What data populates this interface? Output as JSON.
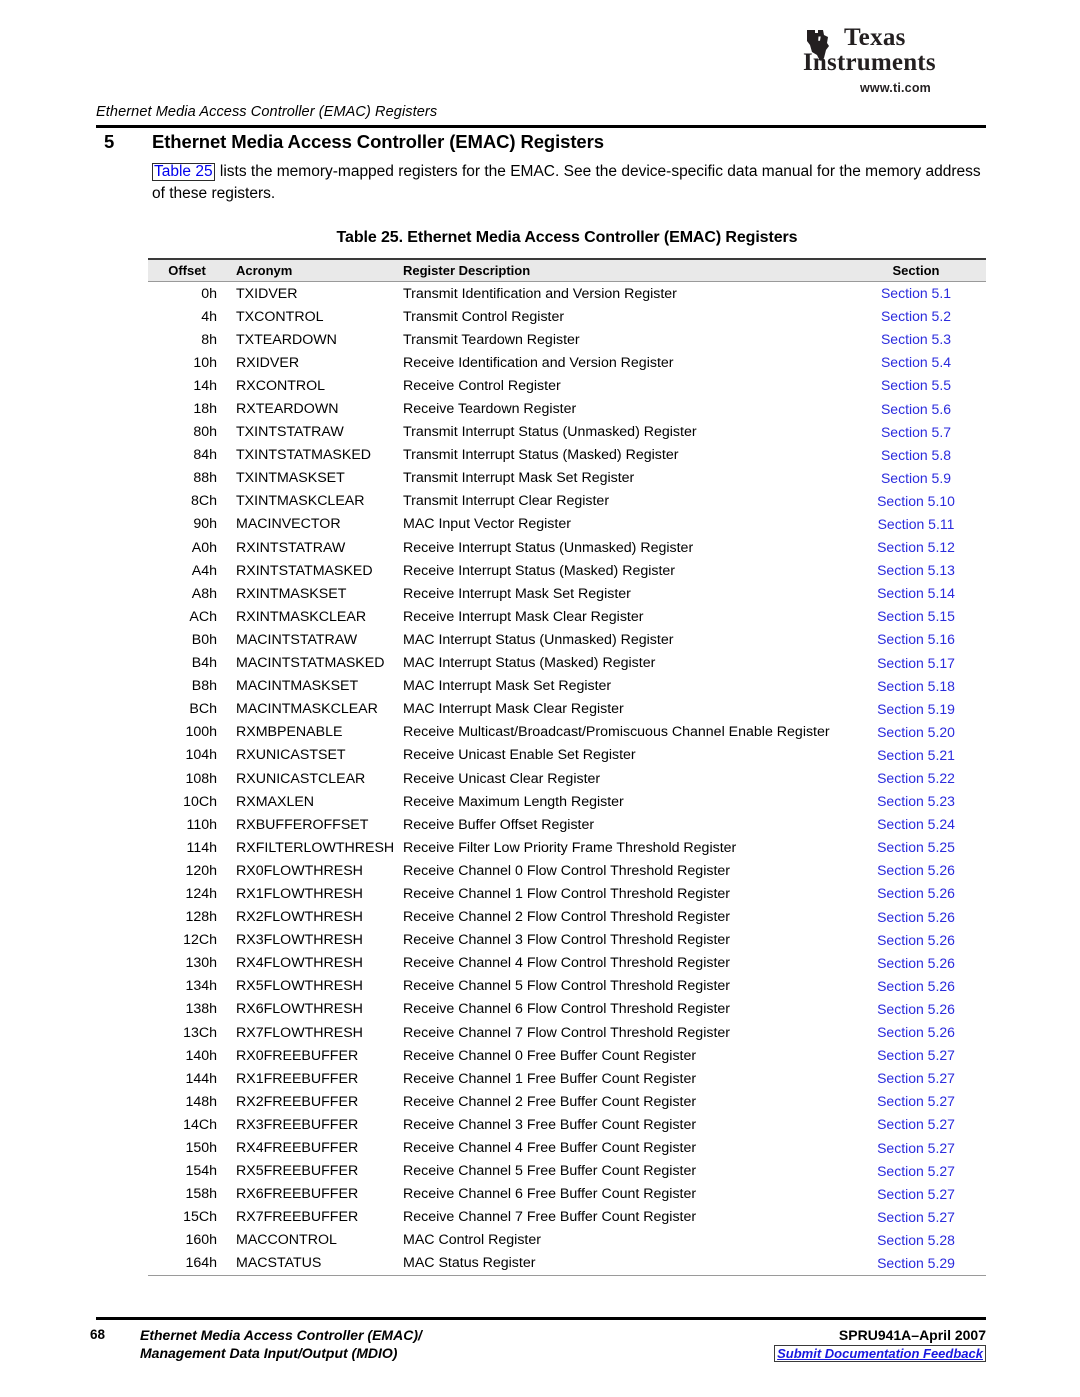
{
  "brand": {
    "name_line1": "Texas",
    "name_line2": "Instruments",
    "url": "www.ti.com",
    "logo_icon": "texas-state-outline-icon"
  },
  "running_head": "Ethernet Media Access Controller (EMAC) Registers",
  "section": {
    "number": "5",
    "title": "Ethernet Media Access Controller (EMAC) Registers",
    "intro_link": "Table 25",
    "intro_text": " lists the memory-mapped registers for the EMAC. See the device-specific data manual for the memory address of these registers."
  },
  "table": {
    "caption": "Table 25. Ethernet Media Access Controller (EMAC) Registers",
    "columns": [
      "Offset",
      "Acronym",
      "Register Description",
      "Section"
    ],
    "rows": [
      [
        "0h",
        "TXIDVER",
        "Transmit Identification and Version Register",
        "Section 5.1"
      ],
      [
        "4h",
        "TXCONTROL",
        "Transmit Control Register",
        "Section 5.2"
      ],
      [
        "8h",
        "TXTEARDOWN",
        "Transmit Teardown Register",
        "Section 5.3"
      ],
      [
        "10h",
        "RXIDVER",
        "Receive Identification and Version Register",
        "Section 5.4"
      ],
      [
        "14h",
        "RXCONTROL",
        "Receive Control Register",
        "Section 5.5"
      ],
      [
        "18h",
        "RXTEARDOWN",
        "Receive Teardown Register",
        "Section 5.6"
      ],
      [
        "80h",
        "TXINTSTATRAW",
        "Transmit Interrupt Status (Unmasked) Register",
        "Section 5.7"
      ],
      [
        "84h",
        "TXINTSTATMASKED",
        "Transmit Interrupt Status (Masked) Register",
        "Section 5.8"
      ],
      [
        "88h",
        "TXINTMASKSET",
        "Transmit Interrupt Mask Set Register",
        "Section 5.9"
      ],
      [
        "8Ch",
        "TXINTMASKCLEAR",
        "Transmit Interrupt Clear Register",
        "Section 5.10"
      ],
      [
        "90h",
        "MACINVECTOR",
        "MAC Input Vector Register",
        "Section 5.11"
      ],
      [
        "A0h",
        "RXINTSTATRAW",
        "Receive Interrupt Status (Unmasked) Register",
        "Section 5.12"
      ],
      [
        "A4h",
        "RXINTSTATMASKED",
        "Receive Interrupt Status (Masked) Register",
        "Section 5.13"
      ],
      [
        "A8h",
        "RXINTMASKSET",
        "Receive Interrupt Mask Set Register",
        "Section 5.14"
      ],
      [
        "ACh",
        "RXINTMASKCLEAR",
        "Receive Interrupt Mask Clear Register",
        "Section 5.15"
      ],
      [
        "B0h",
        "MACINTSTATRAW",
        "MAC Interrupt Status (Unmasked) Register",
        "Section 5.16"
      ],
      [
        "B4h",
        "MACINTSTATMASKED",
        "MAC Interrupt Status (Masked) Register",
        "Section 5.17"
      ],
      [
        "B8h",
        "MACINTMASKSET",
        "MAC Interrupt Mask Set Register",
        "Section 5.18"
      ],
      [
        "BCh",
        "MACINTMASKCLEAR",
        "MAC Interrupt Mask Clear Register",
        "Section 5.19"
      ],
      [
        "100h",
        "RXMBPENABLE",
        "Receive Multicast/Broadcast/Promiscuous Channel Enable Register",
        "Section 5.20"
      ],
      [
        "104h",
        "RXUNICASTSET",
        "Receive Unicast Enable Set Register",
        "Section 5.21"
      ],
      [
        "108h",
        "RXUNICASTCLEAR",
        "Receive Unicast Clear Register",
        "Section 5.22"
      ],
      [
        "10Ch",
        "RXMAXLEN",
        "Receive Maximum Length Register",
        "Section 5.23"
      ],
      [
        "110h",
        "RXBUFFEROFFSET",
        "Receive Buffer Offset Register",
        "Section 5.24"
      ],
      [
        "114h",
        "RXFILTERLOWTHRESH",
        "Receive Filter Low Priority Frame Threshold Register",
        "Section 5.25"
      ],
      [
        "120h",
        "RX0FLOWTHRESH",
        "Receive Channel 0 Flow Control Threshold Register",
        "Section 5.26"
      ],
      [
        "124h",
        "RX1FLOWTHRESH",
        "Receive Channel 1 Flow Control Threshold Register",
        "Section 5.26"
      ],
      [
        "128h",
        "RX2FLOWTHRESH",
        "Receive Channel 2 Flow Control Threshold Register",
        "Section 5.26"
      ],
      [
        "12Ch",
        "RX3FLOWTHRESH",
        "Receive Channel 3 Flow Control Threshold Register",
        "Section 5.26"
      ],
      [
        "130h",
        "RX4FLOWTHRESH",
        "Receive Channel 4 Flow Control Threshold Register",
        "Section 5.26"
      ],
      [
        "134h",
        "RX5FLOWTHRESH",
        "Receive Channel 5 Flow Control Threshold Register",
        "Section 5.26"
      ],
      [
        "138h",
        "RX6FLOWTHRESH",
        "Receive Channel 6 Flow Control Threshold Register",
        "Section 5.26"
      ],
      [
        "13Ch",
        "RX7FLOWTHRESH",
        "Receive Channel 7 Flow Control Threshold Register",
        "Section 5.26"
      ],
      [
        "140h",
        "RX0FREEBUFFER",
        "Receive Channel 0 Free Buffer Count Register",
        "Section 5.27"
      ],
      [
        "144h",
        "RX1FREEBUFFER",
        "Receive Channel 1 Free Buffer Count Register",
        "Section 5.27"
      ],
      [
        "148h",
        "RX2FREEBUFFER",
        "Receive Channel 2 Free Buffer Count Register",
        "Section 5.27"
      ],
      [
        "14Ch",
        "RX3FREEBUFFER",
        "Receive Channel 3 Free Buffer Count Register",
        "Section 5.27"
      ],
      [
        "150h",
        "RX4FREEBUFFER",
        "Receive Channel 4 Free Buffer Count Register",
        "Section 5.27"
      ],
      [
        "154h",
        "RX5FREEBUFFER",
        "Receive Channel 5 Free Buffer Count Register",
        "Section 5.27"
      ],
      [
        "158h",
        "RX6FREEBUFFER",
        "Receive Channel 6 Free Buffer Count Register",
        "Section 5.27"
      ],
      [
        "15Ch",
        "RX7FREEBUFFER",
        "Receive Channel 7 Free Buffer Count Register",
        "Section 5.27"
      ],
      [
        "160h",
        "MACCONTROL",
        "MAC Control Register",
        "Section 5.28"
      ],
      [
        "164h",
        "MACSTATUS",
        "MAC Status Register",
        "Section 5.29"
      ]
    ]
  },
  "footer": {
    "page_number": "68",
    "title_line1": "Ethernet Media Access Controller (EMAC)/",
    "title_line2": "Management Data Input/Output (MDIO)",
    "doc_id": "SPRU941A–April 2007",
    "feedback_link": "Submit Documentation Feedback"
  },
  "colors": {
    "link_blue": "#2b2bdd",
    "rule_black": "#000000",
    "header_band": "#e9e9e9"
  }
}
